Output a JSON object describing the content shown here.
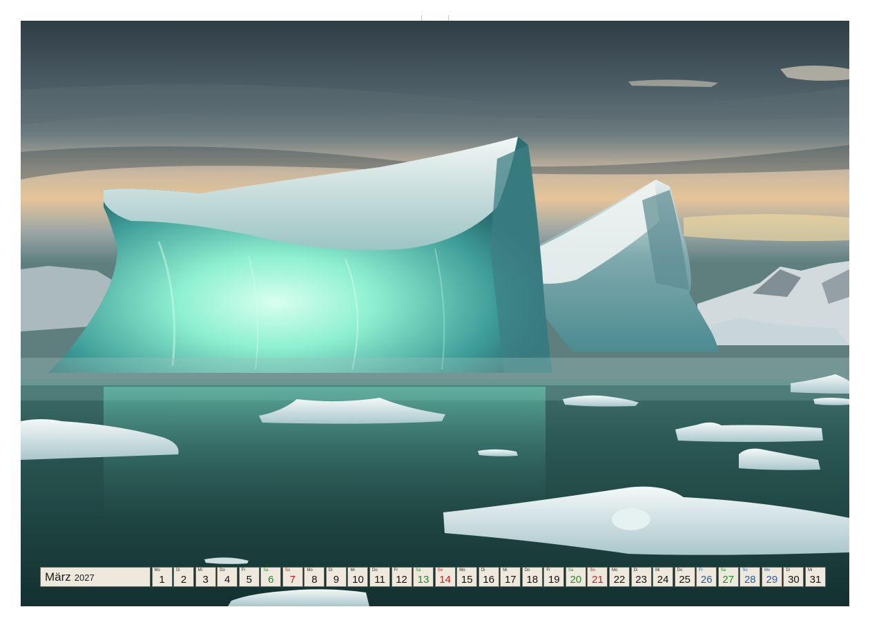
{
  "calendar": {
    "month": "März",
    "year": "2027",
    "days": [
      {
        "wd": "Mo",
        "d": "1",
        "type": "normal"
      },
      {
        "wd": "Di",
        "d": "2",
        "type": "normal"
      },
      {
        "wd": "Mi",
        "d": "3",
        "type": "normal"
      },
      {
        "wd": "Do",
        "d": "4",
        "type": "normal"
      },
      {
        "wd": "Fr",
        "d": "5",
        "type": "normal"
      },
      {
        "wd": "Sa",
        "d": "6",
        "type": "sat"
      },
      {
        "wd": "So",
        "d": "7",
        "type": "sun"
      },
      {
        "wd": "Mo",
        "d": "8",
        "type": "normal"
      },
      {
        "wd": "Di",
        "d": "9",
        "type": "normal"
      },
      {
        "wd": "Mi",
        "d": "10",
        "type": "normal"
      },
      {
        "wd": "Do",
        "d": "11",
        "type": "normal"
      },
      {
        "wd": "Fr",
        "d": "12",
        "type": "normal"
      },
      {
        "wd": "Sa",
        "d": "13",
        "type": "sat"
      },
      {
        "wd": "So",
        "d": "14",
        "type": "sun"
      },
      {
        "wd": "Mo",
        "d": "15",
        "type": "normal"
      },
      {
        "wd": "Di",
        "d": "16",
        "type": "normal"
      },
      {
        "wd": "Mi",
        "d": "17",
        "type": "normal"
      },
      {
        "wd": "Do",
        "d": "18",
        "type": "normal"
      },
      {
        "wd": "Fr",
        "d": "19",
        "type": "normal"
      },
      {
        "wd": "Sa",
        "d": "20",
        "type": "sat"
      },
      {
        "wd": "So",
        "d": "21",
        "type": "sun"
      },
      {
        "wd": "Mo",
        "d": "22",
        "type": "normal"
      },
      {
        "wd": "Di",
        "d": "23",
        "type": "normal"
      },
      {
        "wd": "Mi",
        "d": "24",
        "type": "normal"
      },
      {
        "wd": "Do",
        "d": "25",
        "type": "normal"
      },
      {
        "wd": "Fr",
        "d": "26",
        "type": "hol"
      },
      {
        "wd": "Sa",
        "d": "27",
        "type": "sat"
      },
      {
        "wd": "So",
        "d": "28",
        "type": "hol"
      },
      {
        "wd": "Mo",
        "d": "29",
        "type": "hol"
      },
      {
        "wd": "Di",
        "d": "30",
        "type": "normal"
      },
      {
        "wd": "Mi",
        "d": "31",
        "type": "normal"
      }
    ]
  },
  "photo": {
    "subject": "iceberg-landscape",
    "colors": {
      "sky_top": "#3a4a52",
      "sky_glow": "#e8c89a",
      "ice_glow": "#8ef0d0",
      "ice_body": "#4fa7a6",
      "water": "#1f4a48"
    }
  }
}
